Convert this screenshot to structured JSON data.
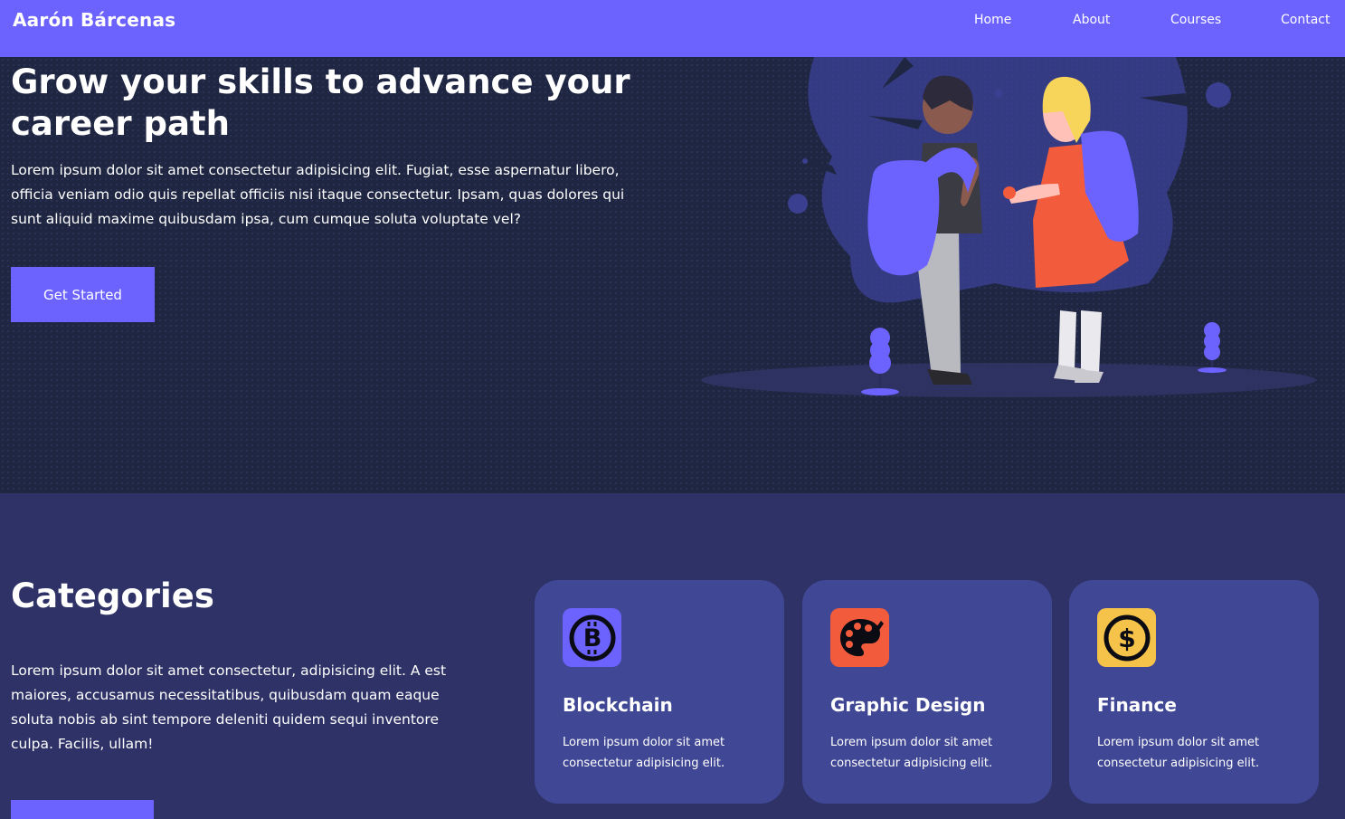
{
  "nav": {
    "brand": "Aarón Bárcenas",
    "links": [
      "Home",
      "About",
      "Courses",
      "Contact"
    ],
    "accent": "#6c63ff"
  },
  "hero": {
    "title": "Grow your skills to advance your career path",
    "text": "Lorem ipsum dolor sit amet consectetur adipisicing elit. Fugiat, esse aspernatur libero, officia veniam odio quis repellat officiis nisi itaque consectetur. Ipsam, quas dolores qui sunt aliquid maxime quibusdam ipsa, cum cumque soluta voluptate vel?",
    "button": "Get Started",
    "background": "#1f2641"
  },
  "categories": {
    "title": "Categories",
    "text": "Lorem ipsum dolor sit amet consectetur, adipisicing elit. A est maiores, accusamus necessitatibus, quibusdam quam eaque soluta nobis ab sint tempore deleniti quidem sequi inventore culpa. Facilis, ullam!",
    "background": "#2e3267",
    "cards": [
      {
        "icon": "bitcoin-icon",
        "title": "Blockchain",
        "text": "Lorem ipsum dolor sit amet consectetur adipisicing elit.",
        "icon_bg": "#6c63ff"
      },
      {
        "icon": "palette-icon",
        "title": "Graphic Design",
        "text": "Lorem ipsum dolor sit amet consectetur adipisicing elit.",
        "icon_bg": "#f25c3d"
      },
      {
        "icon": "dollar-coin-icon",
        "title": "Finance",
        "text": "Lorem ipsum dolor sit amet consectetur adipisicing elit.",
        "icon_bg": "#f6c34a"
      }
    ]
  }
}
